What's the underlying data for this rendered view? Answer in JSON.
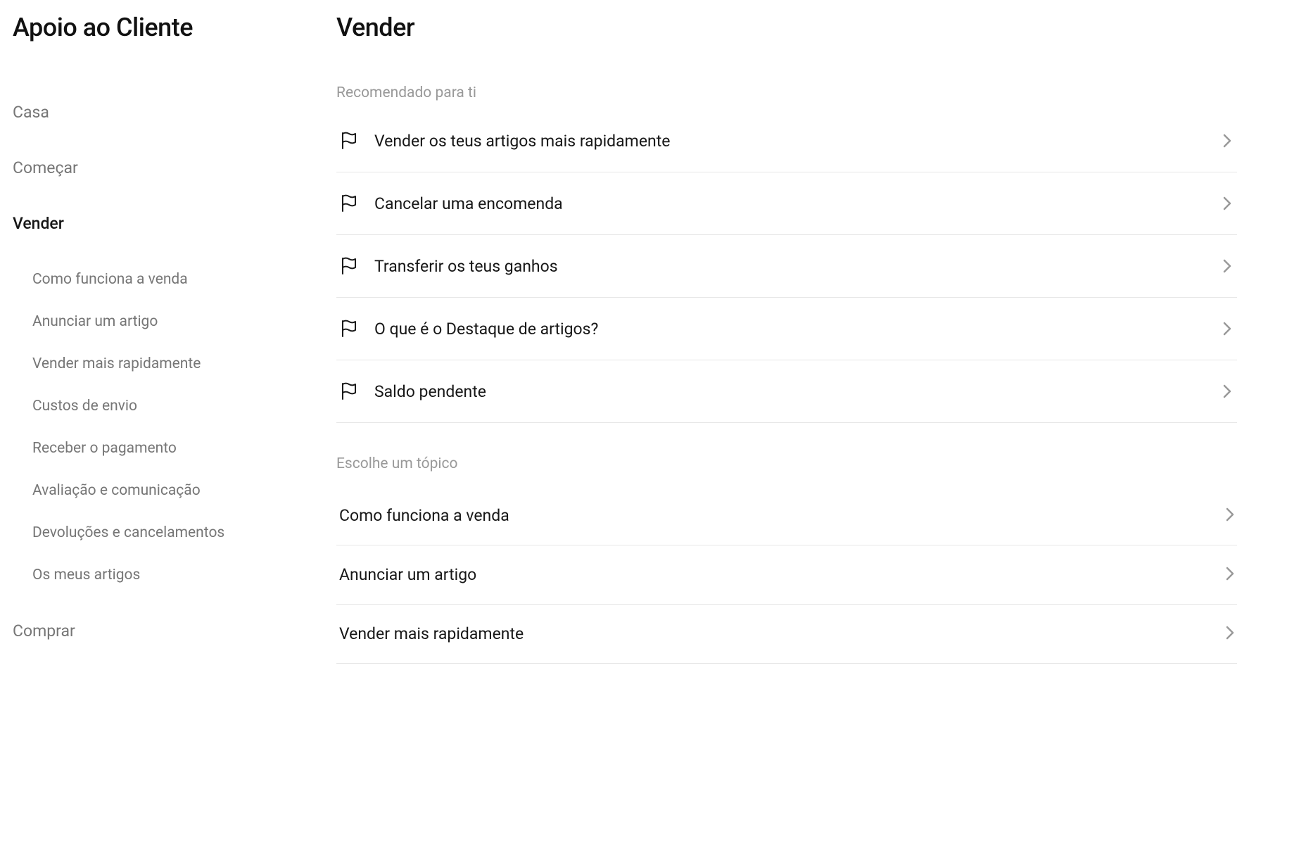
{
  "sidebar": {
    "title": "Apoio ao Cliente",
    "items": [
      {
        "label": "Casa",
        "active": false
      },
      {
        "label": "Começar",
        "active": false
      },
      {
        "label": "Vender",
        "active": true
      },
      {
        "label": "Comprar",
        "active": false
      }
    ],
    "subItems": [
      {
        "label": "Como funciona a venda"
      },
      {
        "label": "Anunciar um artigo"
      },
      {
        "label": "Vender mais rapidamente"
      },
      {
        "label": "Custos de envio"
      },
      {
        "label": "Receber o pagamento"
      },
      {
        "label": "Avaliação e comunicação"
      },
      {
        "label": "Devoluções e cancelamentos"
      },
      {
        "label": "Os meus artigos"
      }
    ]
  },
  "main": {
    "title": "Vender",
    "recommendedLabel": "Recomendado para ti",
    "recommended": [
      {
        "label": "Vender os teus artigos mais rapidamente"
      },
      {
        "label": "Cancelar uma encomenda"
      },
      {
        "label": "Transferir os teus ganhos"
      },
      {
        "label": "O que é o Destaque de artigos?"
      },
      {
        "label": "Saldo pendente"
      }
    ],
    "topicsLabel": "Escolhe um tópico",
    "topics": [
      {
        "label": "Como funciona a venda"
      },
      {
        "label": "Anunciar um artigo"
      },
      {
        "label": "Vender mais rapidamente"
      }
    ]
  }
}
